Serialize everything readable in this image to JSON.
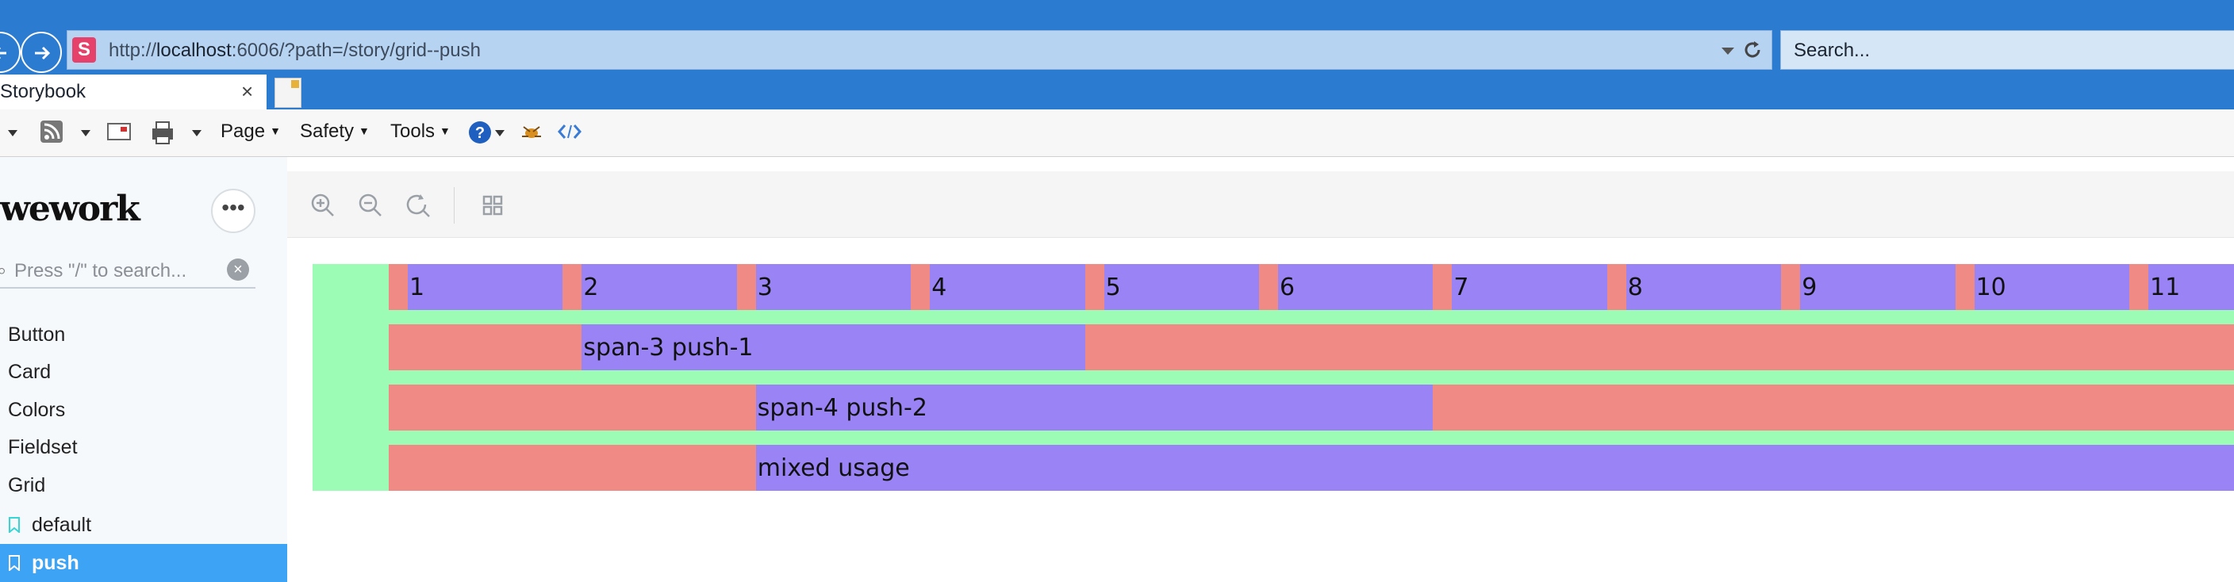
{
  "browser": {
    "url_prefix": "http://",
    "url_host": "localhost",
    "url_rest": ":6006/?path=/story/grid--push",
    "site_icon_letter": "S",
    "search_placeholder": "Search...",
    "tab_title": "Storybook",
    "tab_close": "×",
    "commands": {
      "page": "Page",
      "safety": "Safety",
      "tools": "Tools"
    }
  },
  "sidebar": {
    "brand": "wework",
    "menu_glyph": "•••",
    "search_placeholder": "Press \"/\" to search...",
    "search_clear": "×",
    "components": [
      "Button",
      "Card",
      "Colors",
      "Fieldset",
      "Grid"
    ],
    "stories": [
      {
        "label": "default",
        "active": false
      },
      {
        "label": "push",
        "active": true
      }
    ]
  },
  "grid_demo": {
    "colors": {
      "container": "#9cfcb6",
      "gutter": "#f08a84",
      "column": "#9a84f5"
    },
    "column_labels": [
      "1",
      "2",
      "3",
      "4",
      "5",
      "6",
      "7",
      "8",
      "9",
      "10",
      "11"
    ],
    "rows": [
      {
        "label": "span-3 push-1"
      },
      {
        "label": "span-4 push-2"
      },
      {
        "label": "mixed usage"
      }
    ]
  }
}
